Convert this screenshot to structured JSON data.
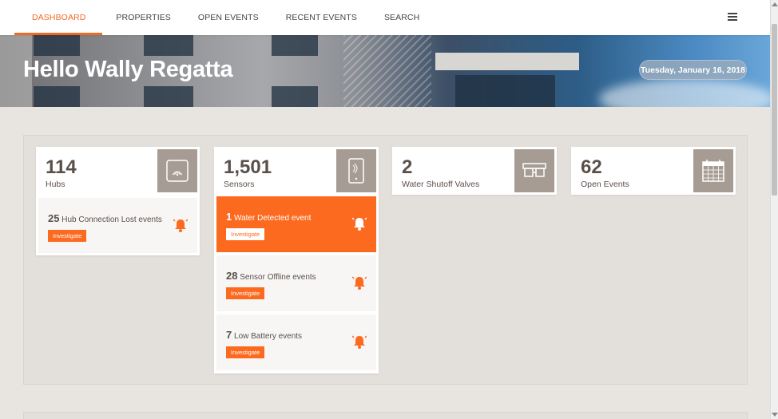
{
  "nav": {
    "tabs": [
      "DASHBOARD",
      "PROPERTIES",
      "OPEN EVENTS",
      "RECENT EVENTS",
      "SEARCH"
    ],
    "active": "DASHBOARD",
    "menu_icon": "hamburger-menu-icon"
  },
  "hero": {
    "greeting": "Hello Wally Regatta",
    "date": "Tuesday, January 16, 2018"
  },
  "cards": {
    "hubs": {
      "count": "114",
      "label": "Hubs",
      "icon": "hub-icon"
    },
    "sensors": {
      "count": "1,501",
      "label": "Sensors",
      "icon": "sensor-icon"
    },
    "valves": {
      "count": "2",
      "label": "Water Shutoff Valves",
      "icon": "valve-icon"
    },
    "events": {
      "count": "62",
      "label": "Open Events",
      "icon": "calendar-icon"
    }
  },
  "events": {
    "hub_lost": {
      "count": "25",
      "text": "Hub Connection Lost events",
      "button": "Investigate"
    },
    "water": {
      "count": "1",
      "text": "Water Detected event",
      "button": "Investigate"
    },
    "offline": {
      "count": "28",
      "text": "Sensor Offline events",
      "button": "Investigate"
    },
    "battery": {
      "count": "7",
      "text": "Low Battery events",
      "button": "Investigate"
    }
  },
  "colors": {
    "accent": "#fc6a1f",
    "icon_bg": "#a69c94",
    "page_bg": "#e8e5e1"
  }
}
